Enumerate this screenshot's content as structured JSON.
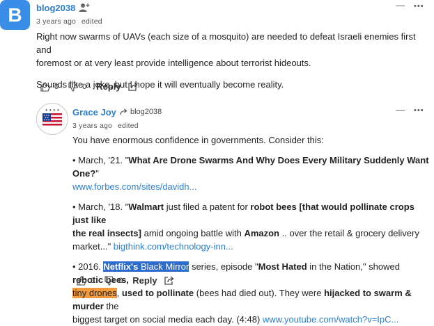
{
  "comment1": {
    "avatar_letter": "B",
    "author": "blog2038",
    "timestamp": "3 years ago",
    "edited": "edited",
    "paragraphs": [
      "Right now swarms of UAVs (each size of a mosquito) are needed to defeat Israeli enemies first and",
      "foremost or at very least provide intelligence about terrorist hideouts.",
      "Sounds like a joke, but I hope it will eventually become reality."
    ],
    "upvotes": "0",
    "downvotes": "0",
    "reply_label": "Reply",
    "collapse": "—",
    "more": "•••"
  },
  "comment2": {
    "author": "Grace Joy",
    "reply_to": "blog2038",
    "timestamp": "3 years ago",
    "edited": "edited",
    "intro": "You have enormous confidence in governments. Consider this:",
    "item1": {
      "prefix": "• March, '21. \"",
      "bold": "What Are Drone Swarms And Why Does Every Military Suddenly Want One?",
      "suffix": "\"",
      "link": "www.forbes.com/sites/davidh..."
    },
    "item2": {
      "prefix": "• March, '18. \"",
      "b1": "Walmart",
      "t1": " just filed a patent for ",
      "b2": "robot bees [that would pollinate crops just like",
      "b3": "the real insects]",
      "t2": " amid ongoing battle with ",
      "b4": "Amazon",
      "t3": " .. over the retail & grocery delivery",
      "t4": "market...\" ",
      "link": "bigthink.com/technology-inn..."
    },
    "item3": {
      "prefix": "• 2016. ",
      "hl_bold": "Netflix's",
      "hl_rest": " Black Mirror",
      "t1": " series, episode \"",
      "b1": "Most Hated",
      "t2": " in the Nation,\" showed ",
      "b2": "robotic bees,",
      "hl2": "tiny drones",
      "t3": ", ",
      "b3": "used to pollinate",
      "t4": " (bees had died out). They were ",
      "b4": "hijacked to swarm & murder",
      "t5": " the",
      "t6": "biggest target on social media each day. (4:48) ",
      "link": "www.youtube.com/watch?v=IpC..."
    },
    "upvotes": "0",
    "downvotes": "0",
    "reply_label": "Reply",
    "collapse": "—",
    "more": "•••"
  },
  "colors": {
    "accent": "#2e7fd3",
    "avatar_bg": "#3b8ee8",
    "highlight_blue": "#2d6ccc",
    "highlight_orange": "#f29a3c"
  }
}
